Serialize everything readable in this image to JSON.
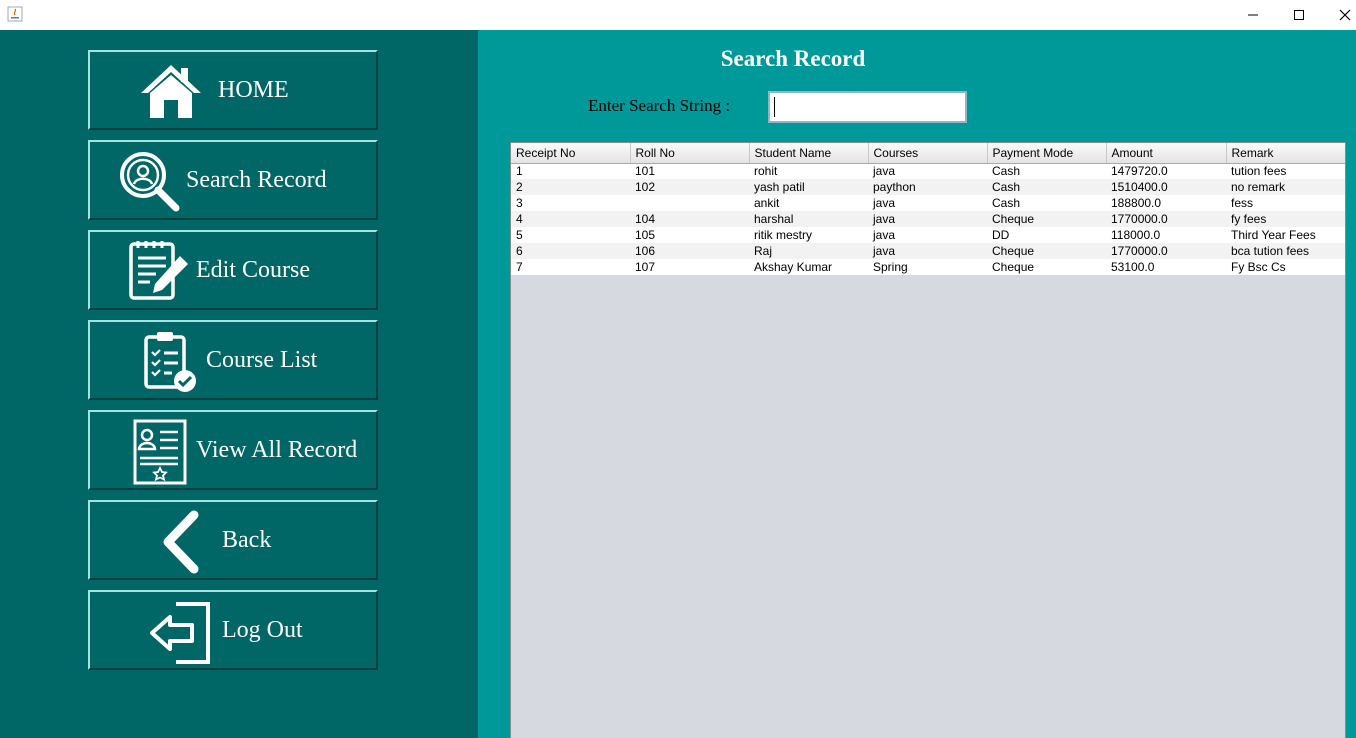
{
  "window": {
    "controls": [
      "minimize-icon",
      "maximize-icon",
      "close-icon"
    ]
  },
  "sidebar": {
    "items": [
      {
        "label": "HOME",
        "icon": "home-icon"
      },
      {
        "label": "Search Record",
        "icon": "search-user-icon"
      },
      {
        "label": "Edit Course",
        "icon": "edit-document-icon"
      },
      {
        "label": "Course List",
        "icon": "clipboard-check-icon"
      },
      {
        "label": "View All Record",
        "icon": "record-card-icon"
      },
      {
        "label": "Back",
        "icon": "chevron-left-icon"
      },
      {
        "label": "Log Out",
        "icon": "logout-icon"
      }
    ]
  },
  "main": {
    "title": "Search Record",
    "search_label": "Enter Search String :",
    "search_value": "",
    "table": {
      "columns": [
        "Receipt No",
        "Roll No",
        "Student Name",
        "Courses",
        "Payment Mode",
        "Amount",
        "Remark"
      ],
      "rows": [
        [
          "1",
          "101",
          "rohit",
          "java",
          "Cash",
          "1479720.0",
          "tution fees"
        ],
        [
          "2",
          "102",
          "yash patil",
          "paython",
          "Cash",
          "1510400.0",
          "no remark"
        ],
        [
          "3",
          "",
          "ankit",
          "java",
          "Cash",
          "188800.0",
          "fess"
        ],
        [
          "4",
          "104",
          "harshal",
          "java",
          "Cheque",
          "1770000.0",
          "fy fees"
        ],
        [
          "5",
          "105",
          "ritik mestry",
          "java",
          "DD",
          "118000.0",
          "Third Year Fees"
        ],
        [
          "6",
          "106",
          "Raj",
          "java",
          "Cheque",
          "1770000.0",
          "bca tution fees"
        ],
        [
          "7",
          "107",
          "Akshay Kumar",
          "Spring",
          "Cheque",
          "53100.0",
          "Fy Bsc Cs"
        ]
      ]
    }
  },
  "colors": {
    "sidebar_bg": "#006666",
    "main_bg": "#009999",
    "table_empty_bg": "#d6d9e0",
    "text_light": "#ffffff"
  }
}
